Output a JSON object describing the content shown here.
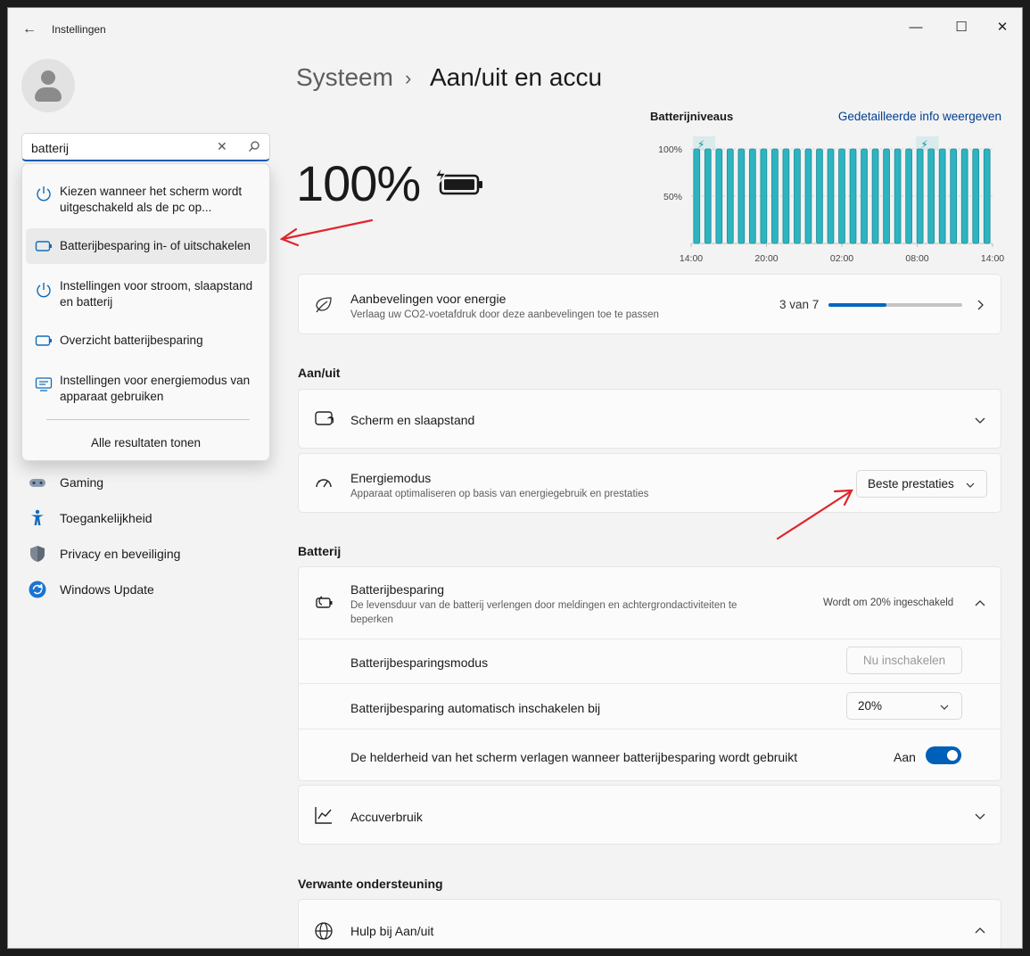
{
  "window": {
    "title": "Instellingen",
    "minimize": "—",
    "maximize": "☐",
    "close": "✕"
  },
  "search": {
    "value": "batterij",
    "results": [
      {
        "label_line1": "Kiezen wanneer het scherm wordt",
        "label_line2": "uitgeschakeld als de pc op...",
        "icon": "power-icon"
      },
      {
        "label_line1": "Batterijbesparing in- of uitschakelen",
        "label_line2": "",
        "icon": "battery-icon"
      },
      {
        "label_line1": "Instellingen voor stroom, slaapstand",
        "label_line2": "en batterij",
        "icon": "power-icon"
      },
      {
        "label_line1": "Overzicht batterijbesparing",
        "label_line2": "",
        "icon": "battery-icon"
      },
      {
        "label_line1": "Instellingen voor energiemodus van",
        "label_line2": "apparaat gebruiken",
        "icon": "device-settings-icon"
      }
    ],
    "all_results": "Alle resultaten tonen"
  },
  "sidebar": {
    "items": [
      {
        "label": "Gaming",
        "icon": "gaming-icon"
      },
      {
        "label": "Toegankelijkheid",
        "icon": "accessibility-icon"
      },
      {
        "label": "Privacy en beveiliging",
        "icon": "shield-icon"
      },
      {
        "label": "Windows Update",
        "icon": "update-icon"
      }
    ]
  },
  "breadcrumb": {
    "parent": "Systeem",
    "separator": "›",
    "current": "Aan/uit en accu"
  },
  "battery": {
    "percent_label": "100%"
  },
  "chart_data": {
    "type": "bar",
    "title": "Batterijniveaus",
    "y_ticks": [
      "100%",
      "50%"
    ],
    "x_ticks": [
      "14:00",
      "20:00",
      "02:00",
      "08:00",
      "14:00"
    ],
    "ylim": [
      0,
      100
    ],
    "values": [
      100,
      100,
      100,
      100,
      100,
      100,
      100,
      100,
      100,
      100,
      100,
      100,
      100,
      100,
      100,
      100,
      100,
      100,
      100,
      100,
      100,
      100,
      100,
      100,
      100,
      100,
      100
    ],
    "color": "#2db4c0",
    "charging_markers": [
      0,
      20
    ]
  },
  "chart_link": "Gedetailleerde info weergeven",
  "recommendations": {
    "title": "Aanbevelingen voor energie",
    "subtitle": "Verlaag uw CO2-voetafdruk door deze aanbevelingen toe te passen",
    "progress_label": "3 van 7",
    "progress_fraction": 0.43
  },
  "section_power": "Aan/uit",
  "screen_sleep": {
    "title": "Scherm en slaapstand"
  },
  "energy_mode": {
    "title": "Energiemodus",
    "subtitle": "Apparaat optimaliseren op basis van energiegebruik en prestaties",
    "value": "Beste prestaties"
  },
  "section_battery": "Batterij",
  "battery_saver": {
    "title": "Batterijbesparing",
    "subtitle_line1": "De levensduur van de batterij verlengen door meldingen en achtergrondactiviteiten te",
    "subtitle_line2": "beperken",
    "status": "Wordt om 20% ingeschakeld",
    "mode_label": "Batterijbesparingsmodus",
    "mode_button": "Nu inschakelen",
    "auto_label": "Batterijbesparing automatisch inschakelen bij",
    "auto_value": "20%",
    "brightness_label": "De helderheid van het scherm verlagen wanneer batterijbesparing wordt gebruikt",
    "brightness_state": "Aan"
  },
  "usage": {
    "title": "Accuverbruik"
  },
  "section_related": "Verwante ondersteuning",
  "help": {
    "title": "Hulp bij Aan/uit"
  },
  "colors": {
    "accent": "#005fb8",
    "arrow": "#e0242c",
    "bar": "#2db4c0"
  }
}
